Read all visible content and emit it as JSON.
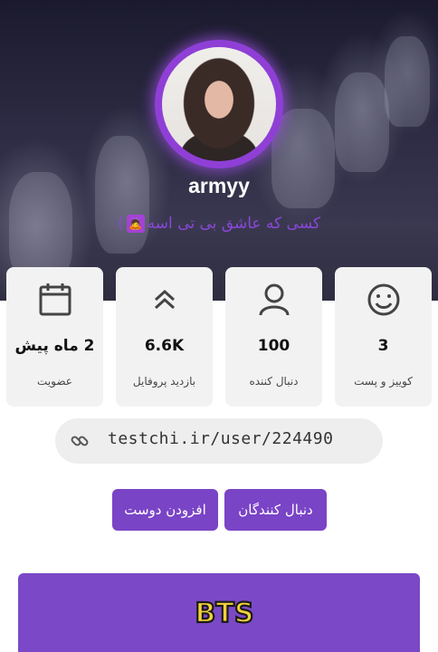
{
  "profile": {
    "username": "armyy",
    "bio_text": "کسی که عاشق بی تی اسه",
    "bio_emoji": "🙇",
    "bio_suffix": ")"
  },
  "stats": [
    {
      "value": "2 ماه پیش",
      "label": "عضویت",
      "icon": "calendar-icon"
    },
    {
      "value": "6.6K",
      "label": "بازدید پروفایل",
      "icon": "chevrons-up-icon"
    },
    {
      "value": "100",
      "label": "دنبال کننده",
      "icon": "user-icon"
    },
    {
      "value": "3",
      "label": "کوییز و پست",
      "icon": "smiley-icon"
    }
  ],
  "profile_link": {
    "text": "testchi.ir/user/224490",
    "icon": "link-icon"
  },
  "buttons": {
    "add_friend": "افزودن دوست",
    "followers": "دنبال کنندگان"
  },
  "banner": {
    "logo_text": "BTS",
    "color": "#7b49c7"
  },
  "colors": {
    "accent": "#7a44c6",
    "ring": "#8f3fd6",
    "bio": "#8a47d8"
  }
}
